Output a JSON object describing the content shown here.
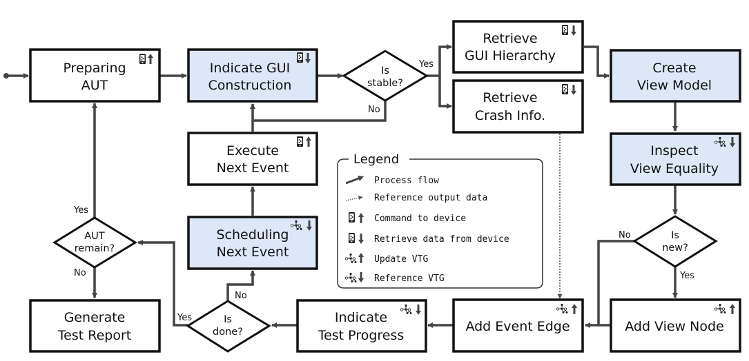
{
  "nodes": {
    "preparing_aut": {
      "line1": "Preparing",
      "line2": "AUT",
      "icon": "device-command-up-icon"
    },
    "indicate_gui": {
      "line1": "Indicate GUI",
      "line2": "Construction",
      "icon": "device-retrieve-down-icon"
    },
    "retrieve_gui": {
      "line1": "Retrieve",
      "line2": "GUI Hierarchy",
      "icon": "device-retrieve-down-icon"
    },
    "retrieve_crash": {
      "line1": "Retrieve",
      "line2": "Crash Info.",
      "icon": "device-retrieve-down-icon"
    },
    "create_view_model": {
      "line1": "Create",
      "line2": "View Model"
    },
    "inspect_view": {
      "line1": "Inspect",
      "line2": "View Equality",
      "icon": "vtg-reference-down-icon"
    },
    "add_view_node": {
      "line1": "Add View Node",
      "icon": "vtg-update-up-icon"
    },
    "add_event_edge": {
      "line1": "Add Event Edge",
      "icon": "vtg-update-up-icon"
    },
    "indicate_progress": {
      "line1": "Indicate",
      "line2": "Test Progress",
      "icon": "vtg-reference-down-icon"
    },
    "generate_report": {
      "line1": "Generate",
      "line2": "Test Report"
    },
    "execute_event": {
      "line1": "Execute",
      "line2": "Next Event",
      "icon": "device-command-up-icon"
    },
    "scheduling_event": {
      "line1": "Scheduling",
      "line2": "Next Event",
      "icon": "vtg-reference-down-icon"
    }
  },
  "decisions": {
    "is_stable": {
      "line1": "Is",
      "line2": "stable?",
      "yes": "Yes",
      "no": "No"
    },
    "is_new": {
      "line1": "Is",
      "line2": "new?",
      "yes": "Yes",
      "no": "No"
    },
    "is_done": {
      "line1": "Is",
      "line2": "done?",
      "yes": "Yes",
      "no": "No"
    },
    "aut_remain": {
      "line1": "AUT",
      "line2": "remain?",
      "yes": "Yes",
      "no": "No"
    }
  },
  "legend": {
    "title": "Legend",
    "items": [
      {
        "label": "Process flow",
        "icon": "process-flow-arrow-icon"
      },
      {
        "label": "Reference output data",
        "icon": "dotted-arrow-icon"
      },
      {
        "label": "Command to device",
        "icon": "device-command-up-icon"
      },
      {
        "label": "Retrieve data from device",
        "icon": "device-retrieve-down-icon"
      },
      {
        "label": "Update VTG",
        "icon": "vtg-update-up-icon"
      },
      {
        "label": "Reference VTG",
        "icon": "vtg-reference-down-icon"
      }
    ]
  },
  "colors": {
    "highlight_fill": "#dde7f7",
    "border": "#111111",
    "arrow": "#444444"
  }
}
